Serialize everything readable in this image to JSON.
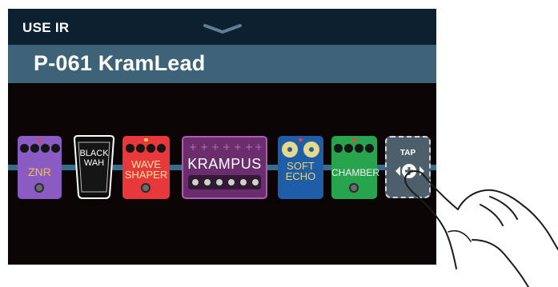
{
  "header": {
    "mode_label": "USE IR",
    "collapse_icon": "chevron-down-icon"
  },
  "patch": {
    "name": "P-061 KramLead"
  },
  "effects": [
    {
      "id": "znr",
      "label": "ZNR",
      "color": "#8a5bc2"
    },
    {
      "id": "black-wah",
      "label_line1": "BLACK",
      "label_line2": "WAH",
      "color": "#111111"
    },
    {
      "id": "wave-shaper",
      "label_line1": "WAVE",
      "label_line2": "SHAPER",
      "color": "#e8383c"
    },
    {
      "id": "krampus",
      "label": "KRAMPUS",
      "color": "#6a2e6c"
    },
    {
      "id": "soft-echo",
      "label_line1": "SOFT",
      "label_line2": "ECHO",
      "color": "#1e5ea8"
    },
    {
      "id": "chamber",
      "label": "CHAMBER",
      "color": "#28a34e"
    }
  ],
  "tap": {
    "label": "TAP",
    "icons": [
      "chevron-left-icon",
      "add-icon",
      "chevron-right-icon"
    ]
  },
  "overlay": {
    "icon": "pointing-hand-icon"
  }
}
